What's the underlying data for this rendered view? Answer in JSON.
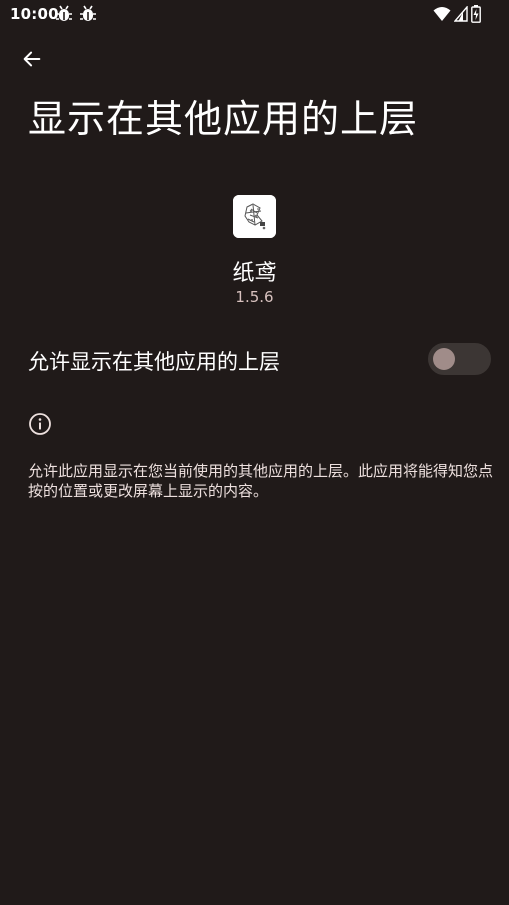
{
  "status_bar": {
    "time": "10:00",
    "notification_icons": [
      "bug-icon",
      "bug-icon"
    ],
    "right_icons": [
      "wifi-icon",
      "signal-icon",
      "battery-icon"
    ]
  },
  "header": {
    "back_icon": "arrow-left-icon",
    "title": "显示在其他应用的上层"
  },
  "app": {
    "name": "纸鸢",
    "version": "1.5.6",
    "icon": "app-icon"
  },
  "permission": {
    "label": "允许显示在其他应用的上层",
    "enabled": false
  },
  "info": {
    "icon": "info-icon",
    "description": "允许此应用显示在您当前使用的其他应用的上层。此应用将能得知您点按的位置或更改屏幕上显示的内容。"
  },
  "colors": {
    "background": "#201a19",
    "text_primary": "#ffffff",
    "text_secondary": "#d8c2bf",
    "toggle_track": "#3c3634",
    "toggle_thumb": "#a08c89"
  }
}
